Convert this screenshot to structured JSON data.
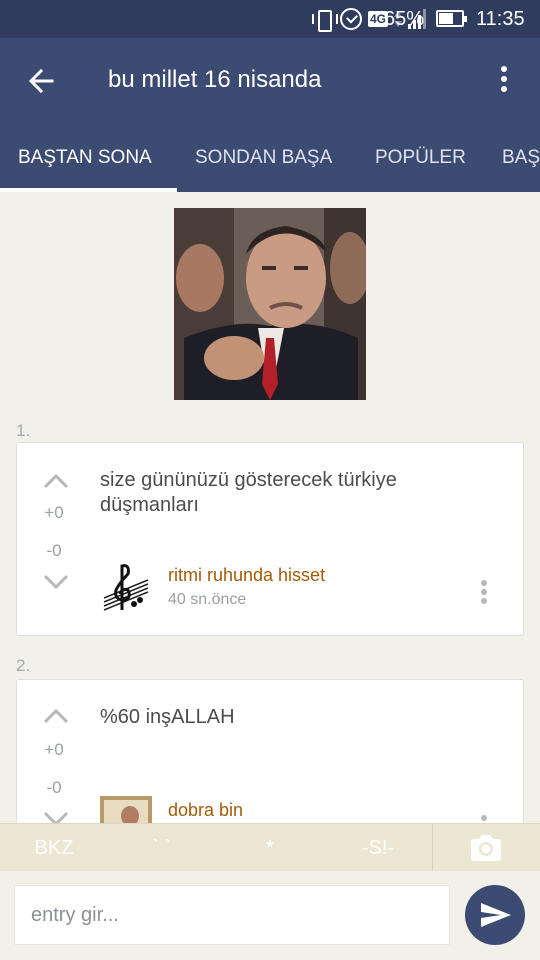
{
  "status_bar": {
    "battery": "65%",
    "time": "11:35",
    "network": "4G"
  },
  "app_bar": {
    "title": "bu millet 16 nisanda",
    "back_icon": "arrow-left-icon",
    "more_icon": "more-vertical-icon"
  },
  "tabs": [
    {
      "label": "BAŞTAN SONA",
      "active": true
    },
    {
      "label": "SONDAN BAŞA",
      "active": false
    },
    {
      "label": "POPÜLER",
      "active": false
    },
    {
      "label": "BAŞ",
      "active": false
    }
  ],
  "topic_image": {
    "caption": "",
    "icon": "topic-photo"
  },
  "entries": [
    {
      "number": "1.",
      "upvotes": "+0",
      "downvotes": "-0",
      "text": "size gününüzü gösterecek türkiye düşmanları",
      "author": "ritmi ruhunda hisset",
      "time": "40 sn.önce",
      "avatar_icon": "treble-clef-avatar"
    },
    {
      "number": "2.",
      "upvotes": "+0",
      "downvotes": "-0",
      "text": "%60 inşALLAH",
      "author": "dobra bin",
      "time": "",
      "avatar_icon": "photo-avatar"
    }
  ],
  "toolbar": {
    "bkz": "BKZ",
    "backticks": "` `",
    "star": "*",
    "spoiler": "-S!-",
    "camera_icon": "camera-icon"
  },
  "composer": {
    "placeholder": "entry gir...",
    "value": "",
    "send_icon": "send-icon"
  },
  "colors": {
    "status_bar": "#2f3c5e",
    "app_bar": "#3b4b72",
    "background": "#f1f0e9",
    "author": "#a35b07",
    "toolbar": "#ebe7d2"
  }
}
